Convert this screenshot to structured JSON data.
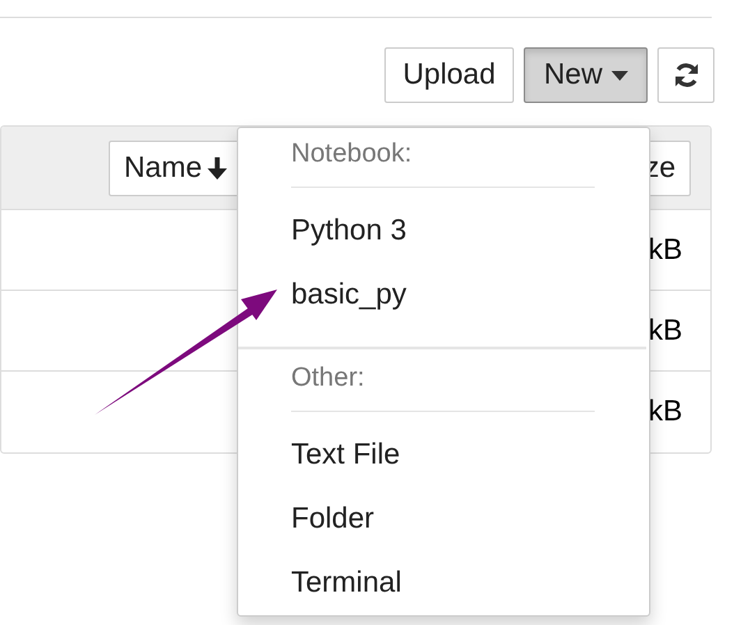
{
  "toolbar": {
    "buttons": [
      {
        "kind": "text",
        "label": "Upload",
        "pressed": false
      },
      {
        "kind": "dropdown",
        "label": "New",
        "pressed": true
      },
      {
        "kind": "refresh",
        "pressed": false
      }
    ]
  },
  "file_list": {
    "header": {
      "name_button": "Name",
      "column_2": "ze"
    },
    "rows": [
      {
        "column_2": "kB"
      },
      {
        "column_2": "kB"
      },
      {
        "column_2": "kB"
      }
    ]
  },
  "new_menu": {
    "sections": [
      {
        "header": "Notebook:",
        "items": [
          "Python 3",
          "basic_py"
        ]
      },
      {
        "header": "Other:",
        "items": [
          "Text File",
          "Folder",
          "Terminal"
        ]
      }
    ]
  }
}
